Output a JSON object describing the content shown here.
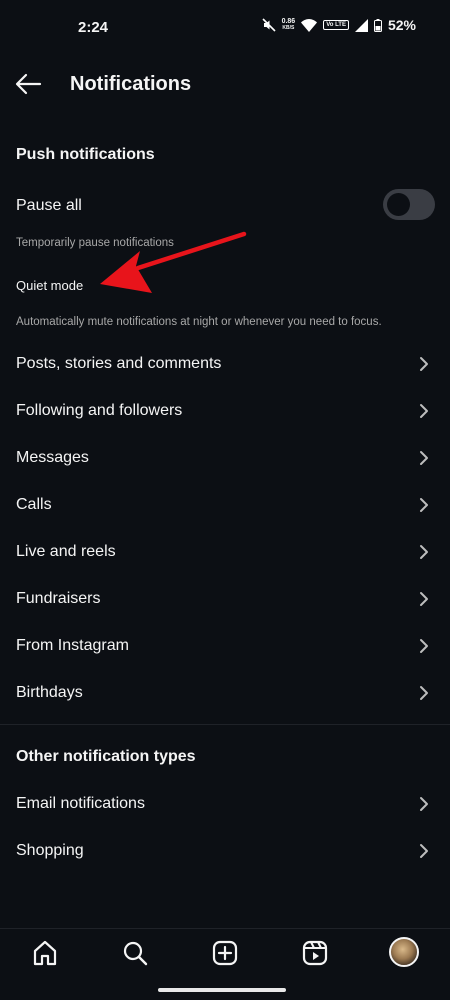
{
  "status_bar": {
    "time": "2:24",
    "net_speed_value": "0.86",
    "net_speed_unit": "KB/S",
    "volte": "Vo LTE",
    "battery": "52%"
  },
  "header": {
    "title": "Notifications"
  },
  "push_section": {
    "title": "Push notifications",
    "pause_all_label": "Pause all",
    "pause_all_enabled": false,
    "pause_all_sub": "Temporarily pause notifications",
    "quiet_mode_label": "Quiet mode",
    "quiet_mode_sub": "Automatically mute notifications at night or whenever you need to focus."
  },
  "push_items": [
    {
      "label": "Posts, stories and comments"
    },
    {
      "label": "Following and followers"
    },
    {
      "label": "Messages"
    },
    {
      "label": "Calls"
    },
    {
      "label": "Live and reels"
    },
    {
      "label": "Fundraisers"
    },
    {
      "label": "From Instagram"
    },
    {
      "label": "Birthdays"
    }
  ],
  "other_section": {
    "title": "Other notification types",
    "items": [
      {
        "label": "Email notifications"
      },
      {
        "label": "Shopping"
      }
    ]
  },
  "bottom_nav": {
    "items": [
      "home-icon",
      "search-icon",
      "create-icon",
      "reels-icon",
      "profile-avatar"
    ]
  },
  "colors": {
    "background": "#0c0f14",
    "text": "#f5f5f5",
    "subtext": "#a8a8a8",
    "annotation_arrow": "#e8141b"
  }
}
